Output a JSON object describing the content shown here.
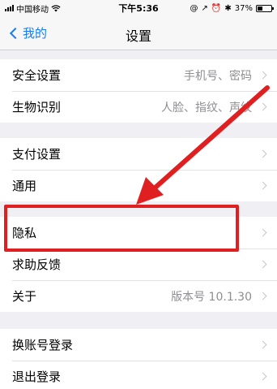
{
  "status": {
    "carrier": "中国移动",
    "time": "下午5:36",
    "battery": "37%",
    "battery_level": 0.37
  },
  "nav": {
    "back_label": "我的",
    "title": "设置"
  },
  "groups": [
    {
      "items": [
        {
          "label": "安全设置",
          "value": "手机号、密码"
        },
        {
          "label": "生物识别",
          "value": "人脸、指纹、声纹"
        }
      ]
    },
    {
      "items": [
        {
          "label": "支付设置",
          "value": ""
        },
        {
          "label": "通用",
          "value": ""
        }
      ]
    },
    {
      "items": [
        {
          "label": "隐私",
          "value": ""
        },
        {
          "label": "求助反馈",
          "value": ""
        },
        {
          "label": "关于",
          "value": "版本号 10.1.30"
        }
      ]
    },
    {
      "items": [
        {
          "label": "换账号登录",
          "value": ""
        },
        {
          "label": "退出登录",
          "value": ""
        }
      ]
    }
  ],
  "annotation": {
    "color": "#e02020",
    "highlighted_item": "隐私"
  }
}
